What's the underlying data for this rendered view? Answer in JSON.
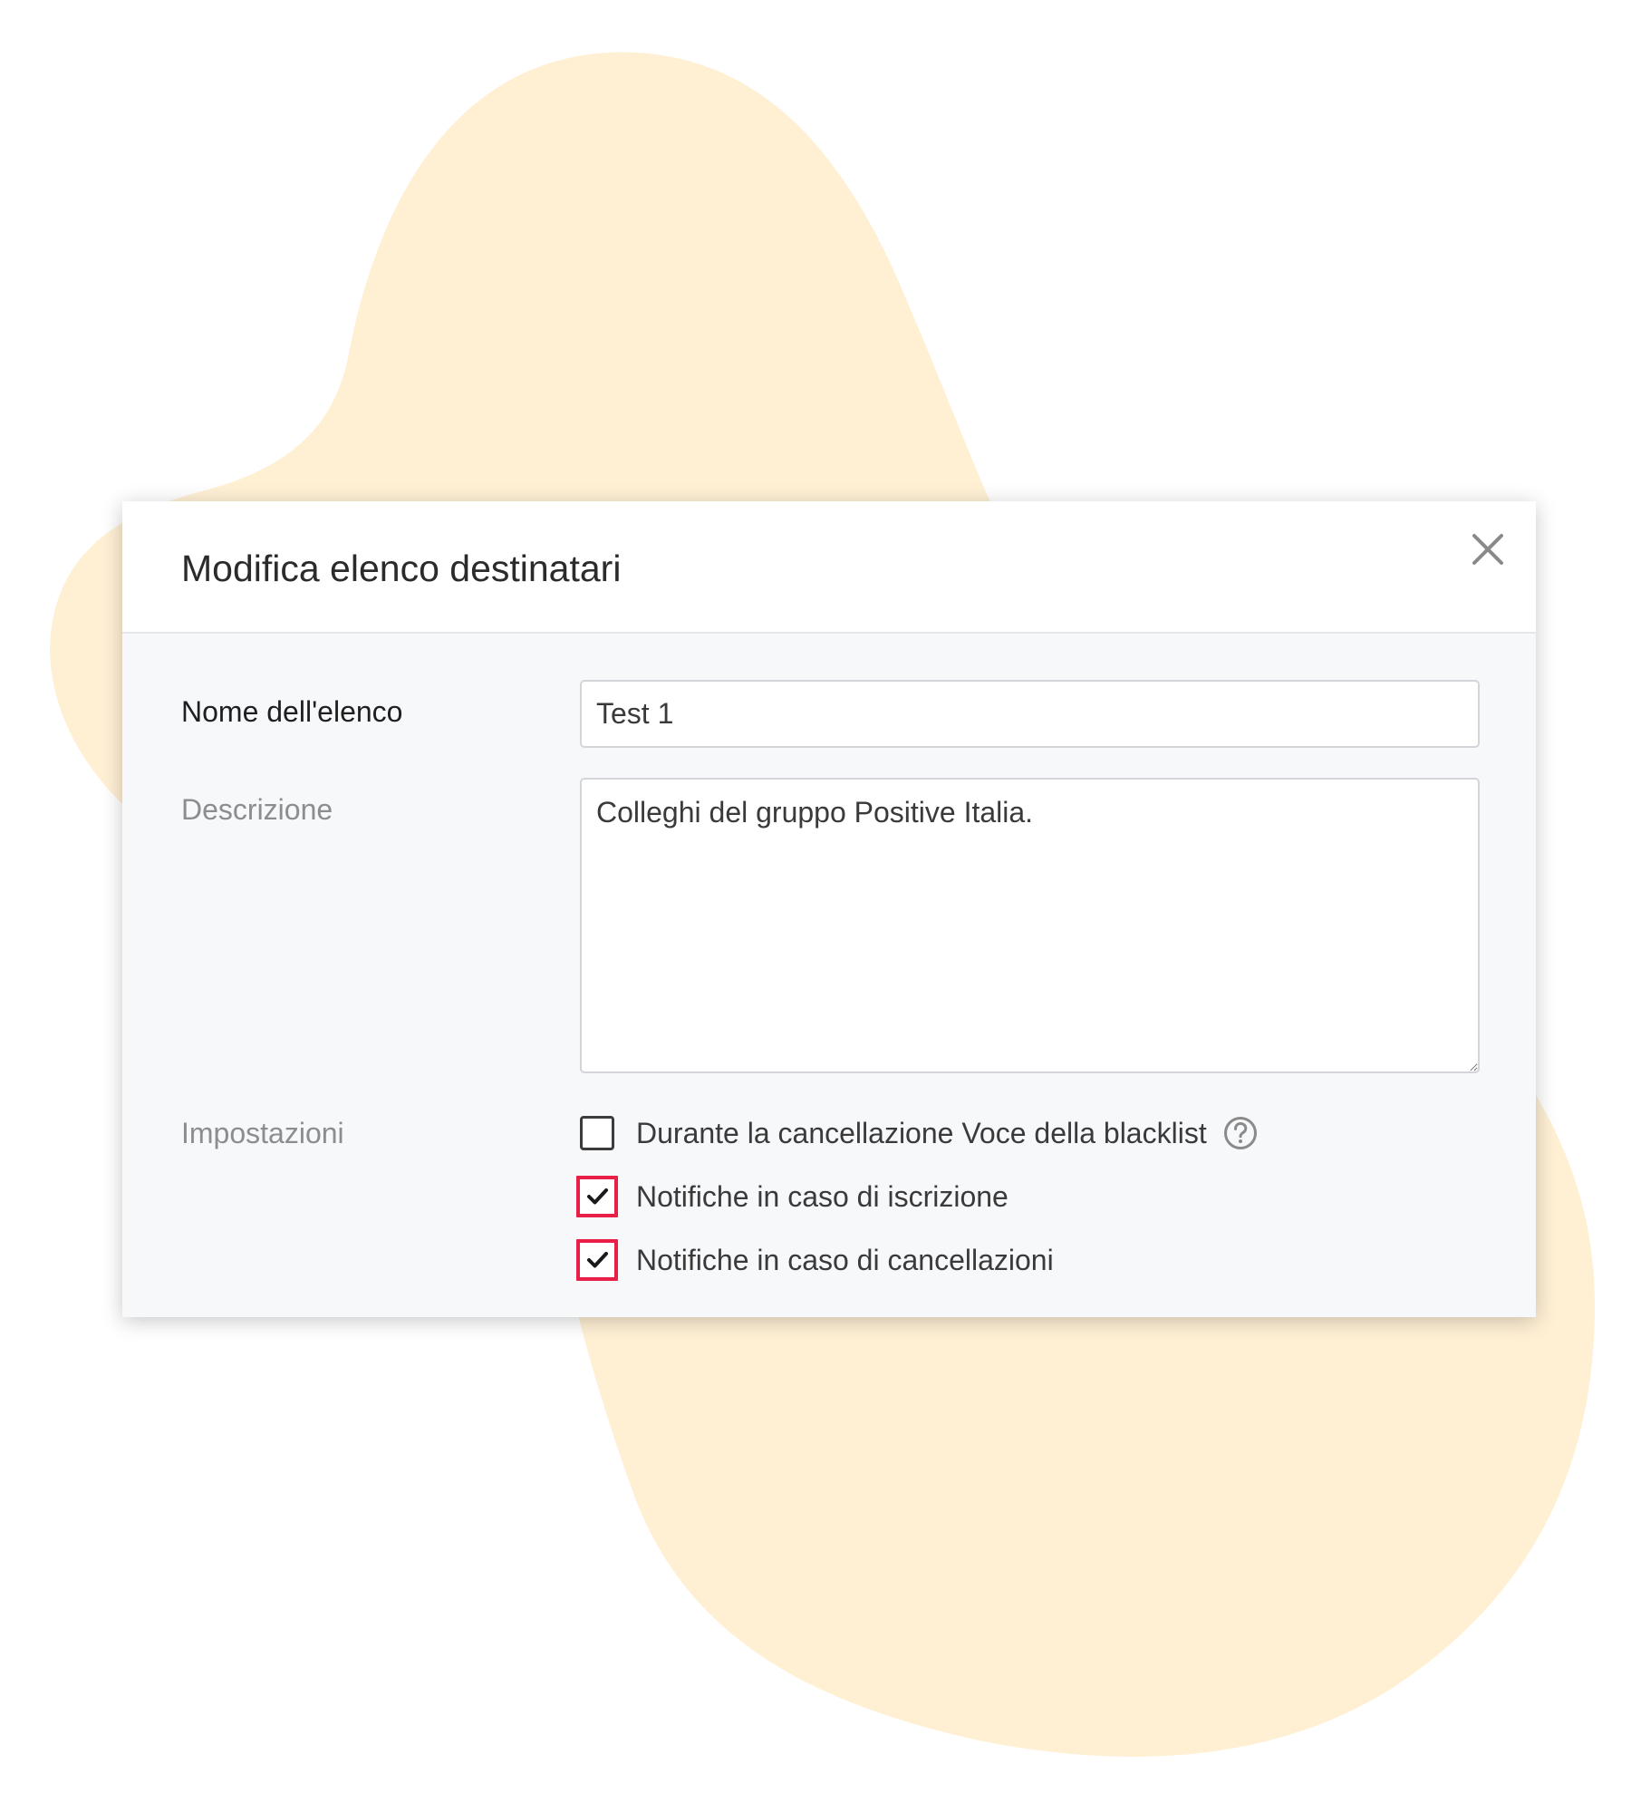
{
  "modal": {
    "title": "Modifica elenco destinatari",
    "close_icon": "close-icon"
  },
  "form": {
    "name_label": "Nome dell'elenco",
    "name_value": "Test 1",
    "description_label": "Descrizione",
    "description_value": "Colleghi del gruppo Positive Italia.",
    "settings_label": "Impostazioni",
    "options": [
      {
        "label": "Durante la cancellazione Voce della blacklist",
        "checked": false,
        "help_icon": "question-circle-icon"
      },
      {
        "label": "Notifiche in caso di iscrizione",
        "checked": true
      },
      {
        "label": "Notifiche in caso di cancellazioni",
        "checked": true
      }
    ]
  },
  "colors": {
    "highlight": "#ea1f48",
    "blob": "#fff0d4",
    "panel": "#f7f8fa"
  }
}
